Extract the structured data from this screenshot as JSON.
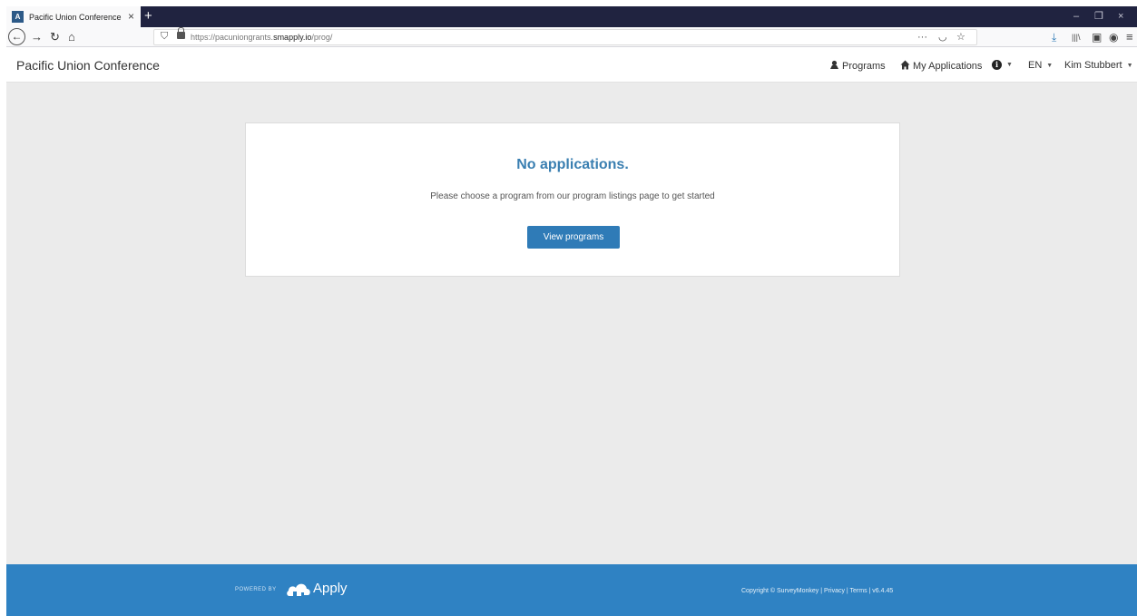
{
  "browser": {
    "tab_title": "Pacific Union Conference",
    "favicon_letter": "A",
    "tab_close": "×",
    "new_tab": "+",
    "url_prefix": "https://pacuniongrants.",
    "url_domain": "smapply.io",
    "url_path": "/prog/",
    "page_actions": "···",
    "window_controls": {
      "minimize": "–",
      "restore": "❐",
      "close": "×"
    },
    "icons": {
      "back": "←",
      "forward": "→",
      "reload": "↻",
      "home": "⌂",
      "pocket": "◡",
      "star": "☆",
      "download": "⤓",
      "library": "|||\\",
      "sidebar": "▣",
      "account": "◉",
      "menu": "≡",
      "shield": "⛉"
    }
  },
  "header": {
    "brand": "Pacific Union Conference",
    "nav": {
      "programs": "Programs",
      "my_applications": "My Applications",
      "info": "i",
      "language": "EN",
      "user": "Kim Stubbert"
    }
  },
  "main": {
    "title": "No applications.",
    "subtitle": "Please choose a program from our program listings page to get started",
    "button": "View programs"
  },
  "footer": {
    "powered_by": "POWERED BY",
    "logo_text": "Apply",
    "copyright": "Copyright © SurveyMonkey | Privacy | Terms | v6.4.45"
  },
  "colors": {
    "accent": "#2f7bb7",
    "title": "#3a7fb1",
    "footer": "#2f82c3",
    "tabbar": "#202340",
    "background": "#ebebeb"
  }
}
